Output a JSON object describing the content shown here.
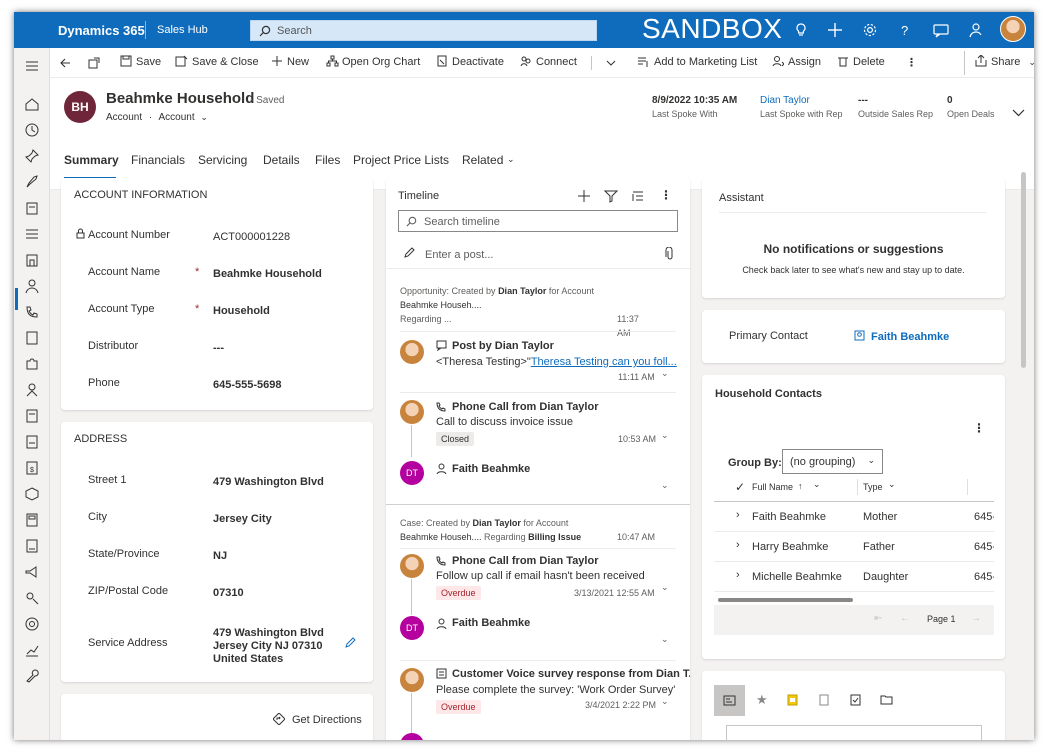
{
  "topbar": {
    "app_name": "Dynamics 365",
    "area_name": "Sales Hub",
    "search_placeholder": "Search",
    "environment_label": "SANDBOX"
  },
  "commands": {
    "save": "Save",
    "save_close": "Save & Close",
    "new": "New",
    "open_org_chart": "Open Org Chart",
    "deactivate": "Deactivate",
    "connect": "Connect",
    "add_to_marketing_list": "Add to Marketing List",
    "assign": "Assign",
    "delete": "Delete",
    "share": "Share"
  },
  "record": {
    "initials": "BH",
    "title": "Beahmke Household",
    "saved_label": "- Saved",
    "entity": "Account",
    "form": "Account"
  },
  "header_fields": [
    {
      "value": "8/9/2022 10:35 AM",
      "label": "Last Spoke With"
    },
    {
      "value": "Dian Taylor",
      "label": "Last Spoke with Rep"
    },
    {
      "value": "---",
      "label": "Outside Sales Rep"
    },
    {
      "value": "0",
      "label": "Open Deals"
    }
  ],
  "tabs": [
    "Summary",
    "Financials",
    "Servicing",
    "Details",
    "Files",
    "Project Price Lists",
    "Related"
  ],
  "account_info": {
    "title": "ACCOUNT INFORMATION",
    "account_number_label": "Account Number",
    "account_number": "ACT000001228",
    "account_name_label": "Account Name",
    "account_name": "Beahmke Household",
    "account_type_label": "Account Type",
    "account_type": "Household",
    "distributor_label": "Distributor",
    "distributor": "---",
    "phone_label": "Phone",
    "phone": "645-555-5698",
    "required_mark": "*"
  },
  "address": {
    "title": "ADDRESS",
    "street_label": "Street 1",
    "street": "479 Washington Blvd",
    "city_label": "City",
    "city": "Jersey City",
    "state_label": "State/Province",
    "state": "NJ",
    "zip_label": "ZIP/Postal Code",
    "zip": "07310",
    "service_label": "Service Address",
    "service_line1": "479 Washington Blvd",
    "service_line2": "Jersey City NJ 07310",
    "service_line3": "United States",
    "directions": "Get Directions"
  },
  "timeline": {
    "title": "Timeline",
    "search_placeholder": "Search timeline",
    "post_placeholder": "Enter a post...",
    "group1_meta_a": "Opportunity: Created by ",
    "group1_meta_b": "Dian Taylor",
    "group1_meta_c": " for Account",
    "group1_meta_d": "Beahmke Househ....",
    "group1_regarding": "Regarding ...",
    "group1_time": "11:37 AM",
    "post_title": "Post by Dian Taylor",
    "post_body_a": "<Theresa Testing>\"",
    "post_body_b": "Theresa Testing can you foll...",
    "post_time": "11:11 AM",
    "call1_title": "Phone Call from Dian Taylor",
    "call1_desc": "Call to discuss invoice issue",
    "call1_status": "Closed",
    "call1_time": "10:53 AM",
    "dt_initials": "DT",
    "contact1": "Faith Beahmke",
    "group2_meta_a": "Case: Created by ",
    "group2_meta_b": "Dian Taylor",
    "group2_meta_c": " for Account",
    "group2_meta_d": "Beahmke Househ....",
    "group2_meta_e": " Regarding ",
    "group2_meta_f": "Billing Issue",
    "group2_time": "10:47 AM",
    "call2_title": "Phone Call from Dian Taylor",
    "call2_desc": "Follow up call if email hasn't been received",
    "call2_status": "Overdue",
    "call2_time": "3/13/2021 12:55 AM",
    "contact2": "Faith Beahmke",
    "survey_title": "Customer Voice survey response from Dian T...",
    "survey_desc": "Please complete the survey: 'Work Order Survey'",
    "survey_status": "Overdue",
    "survey_time": "3/4/2021 2:22 PM"
  },
  "assistant": {
    "title": "Assistant",
    "empty_title": "No notifications or suggestions",
    "empty_body": "Check back later to see what's new and stay up to date."
  },
  "primary_contact": {
    "label": "Primary Contact",
    "name": "Faith Beahmke"
  },
  "household": {
    "title": "Household Contacts",
    "group_by_label": "Group By:",
    "group_by_value": "(no grouping)",
    "col_full_name": "Full Name",
    "col_type": "Type",
    "rows": [
      {
        "name": "Faith Beahmke",
        "type": "Mother",
        "phone": "645-"
      },
      {
        "name": "Harry Beahmke",
        "type": "Father",
        "phone": "645-"
      },
      {
        "name": "Michelle Beahmke",
        "type": "Daughter",
        "phone": "645-"
      }
    ],
    "page_label": "Page 1"
  },
  "colors": {
    "brand": "#0f6cbd",
    "avatar_bh": "#70263a",
    "avatar_dt": "#b4009e",
    "overdue_bg": "#fde7e9",
    "overdue_text": "#a4262c"
  }
}
